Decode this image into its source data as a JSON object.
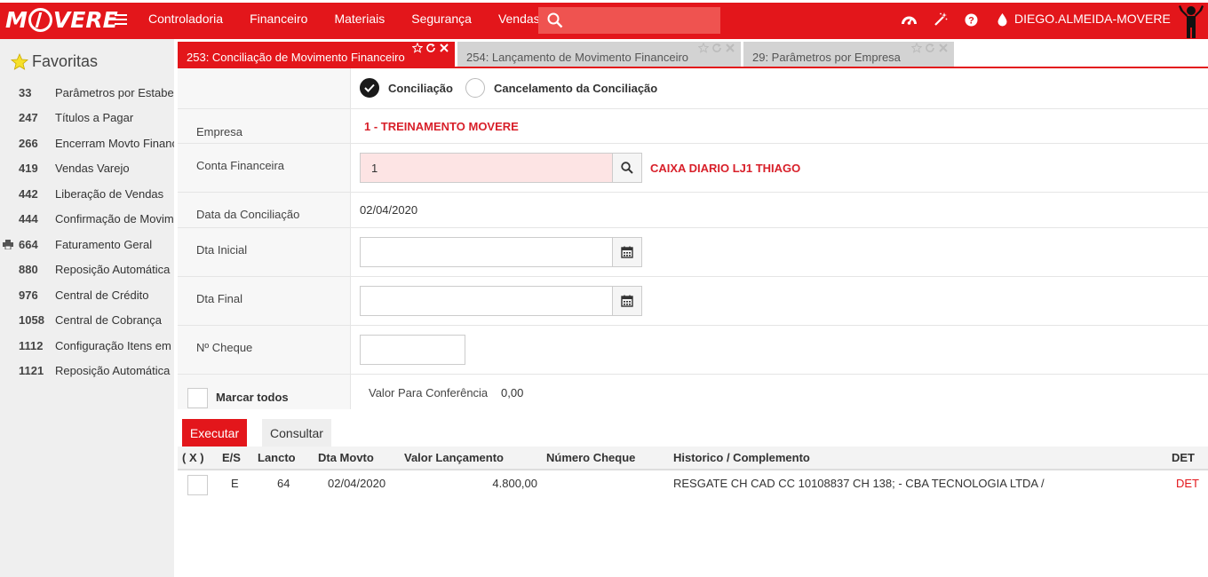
{
  "brand": {
    "logo_text": "MOVERE"
  },
  "header": {
    "menu": [
      "Controladoria",
      "Financeiro",
      "Materiais",
      "Segurança",
      "Vendas"
    ],
    "search_placeholder": "",
    "username": "DIEGO.ALMEIDA-MOVERE",
    "icons": [
      "dashboard-icon",
      "magic-wand-icon",
      "help-icon",
      "drop-icon"
    ]
  },
  "sidebar": {
    "title": "Favoritas",
    "items": [
      {
        "code": "33",
        "label": "Parâmetros por Estabelecimento"
      },
      {
        "code": "247",
        "label": "Títulos a Pagar"
      },
      {
        "code": "266",
        "label": "Encerram Movto Financeiro"
      },
      {
        "code": "419",
        "label": "Vendas Varejo"
      },
      {
        "code": "442",
        "label": "Liberação de Vendas"
      },
      {
        "code": "444",
        "label": "Confirmação de Movimento"
      },
      {
        "code": "664",
        "label": "Faturamento Geral"
      },
      {
        "code": "880",
        "label": "Reposição Automática"
      },
      {
        "code": "976",
        "label": "Central de Crédito"
      },
      {
        "code": "1058",
        "label": "Central de Cobrança"
      },
      {
        "code": "1112",
        "label": "Configuração Itens em"
      },
      {
        "code": "1121",
        "label": "Reposição Automática"
      }
    ]
  },
  "tabs": [
    {
      "label": "253: Conciliação de Movimento Financeiro",
      "active": true
    },
    {
      "label": "254: Lançamento de Movimento Financeiro",
      "active": false
    },
    {
      "label": "29: Parâmetros por Empresa",
      "active": false
    }
  ],
  "form": {
    "mode_options": [
      {
        "label": "Conciliação",
        "checked": true
      },
      {
        "label": "Cancelamento da Conciliação",
        "checked": false
      }
    ],
    "empresa_label": "Empresa",
    "empresa_value": "1 - TREINAMENTO MOVERE",
    "conta_label": "Conta Financeira",
    "conta_value": "1",
    "conta_desc": "CAIXA DIARIO LJ1 THIAGO",
    "data_conciliacao_label": "Data da Conciliação",
    "data_conciliacao_value": "02/04/2020",
    "dta_inicial_label": "Dta Inicial",
    "dta_inicial_value": "",
    "dta_final_label": "Dta Final",
    "dta_final_value": "",
    "cheque_label": "Nº Cheque",
    "cheque_value": "",
    "marcar_todos_label": "Marcar todos",
    "valor_conferencia_label": "Valor Para Conferência",
    "valor_conferencia_value": "0,00"
  },
  "actions": {
    "executar": "Executar",
    "consultar": "Consultar"
  },
  "table": {
    "columns": [
      "( X )",
      "E/S",
      "Lancto",
      "Dta Movto",
      "Valor Lançamento",
      "Número Cheque",
      "Historico / Complemento",
      "DET"
    ],
    "rows": [
      {
        "es": "E",
        "lancto": "64",
        "dta_movto": "02/04/2020",
        "valor": "4.800,00",
        "cheque": "",
        "historico": "RESGATE CH CAD CC 10108837 CH 138; - CBA TECNOLOGIA LTDA /",
        "det": "DET"
      }
    ]
  },
  "colors": {
    "brand_red": "#e3161b",
    "highlight_red": "#d8202a",
    "input_pink": "#fde4e4"
  }
}
